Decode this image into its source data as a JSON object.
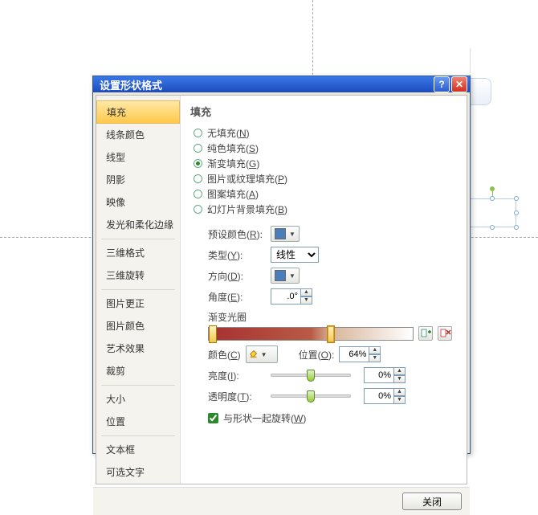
{
  "dialog": {
    "title": "设置形状格式",
    "close_button": "关闭"
  },
  "sidebar": {
    "items": [
      "填充",
      "线条颜色",
      "线型",
      "阴影",
      "映像",
      "发光和柔化边缘",
      "三维格式",
      "三维旋转",
      "图片更正",
      "图片颜色",
      "艺术效果",
      "裁剪",
      "大小",
      "位置",
      "文本框",
      "可选文字"
    ],
    "selected_index": 0
  },
  "main": {
    "heading": "填充",
    "radios": [
      {
        "label": "无填充(N)",
        "u": "N"
      },
      {
        "label": "纯色填充(S)",
        "u": "S"
      },
      {
        "label": "渐变填充(G)",
        "u": "G"
      },
      {
        "label": "图片或纹理填充(P)",
        "u": "P"
      },
      {
        "label": "图案填充(A)",
        "u": "A"
      },
      {
        "label": "幻灯片背景填充(B)",
        "u": "B"
      }
    ],
    "selected_radio": 2,
    "preset_label": "预设颜色(R):",
    "type_label": "类型(Y):",
    "type_value": "线性",
    "direction_label": "方向(D):",
    "angle_label": "角度(E):",
    "angle_value": ".0°",
    "gradient_stops_label": "渐变光圈",
    "gradient_stops_pos": [
      "2%",
      "60%"
    ],
    "add_stop_title": "添加渐变光圈",
    "remove_stop_title": "删除渐变光圈",
    "color_label": "颜色(C)",
    "position_label": "位置(O):",
    "position_value": "64%",
    "brightness_label": "亮度(I):",
    "brightness_value": "0%",
    "brightness_slider": "50%",
    "transparency_label": "透明度(T):",
    "transparency_value": "0%",
    "transparency_slider": "50%",
    "rotate_with_shape_label": "与形状一起旋转(W)",
    "rotate_with_shape_checked": true
  }
}
